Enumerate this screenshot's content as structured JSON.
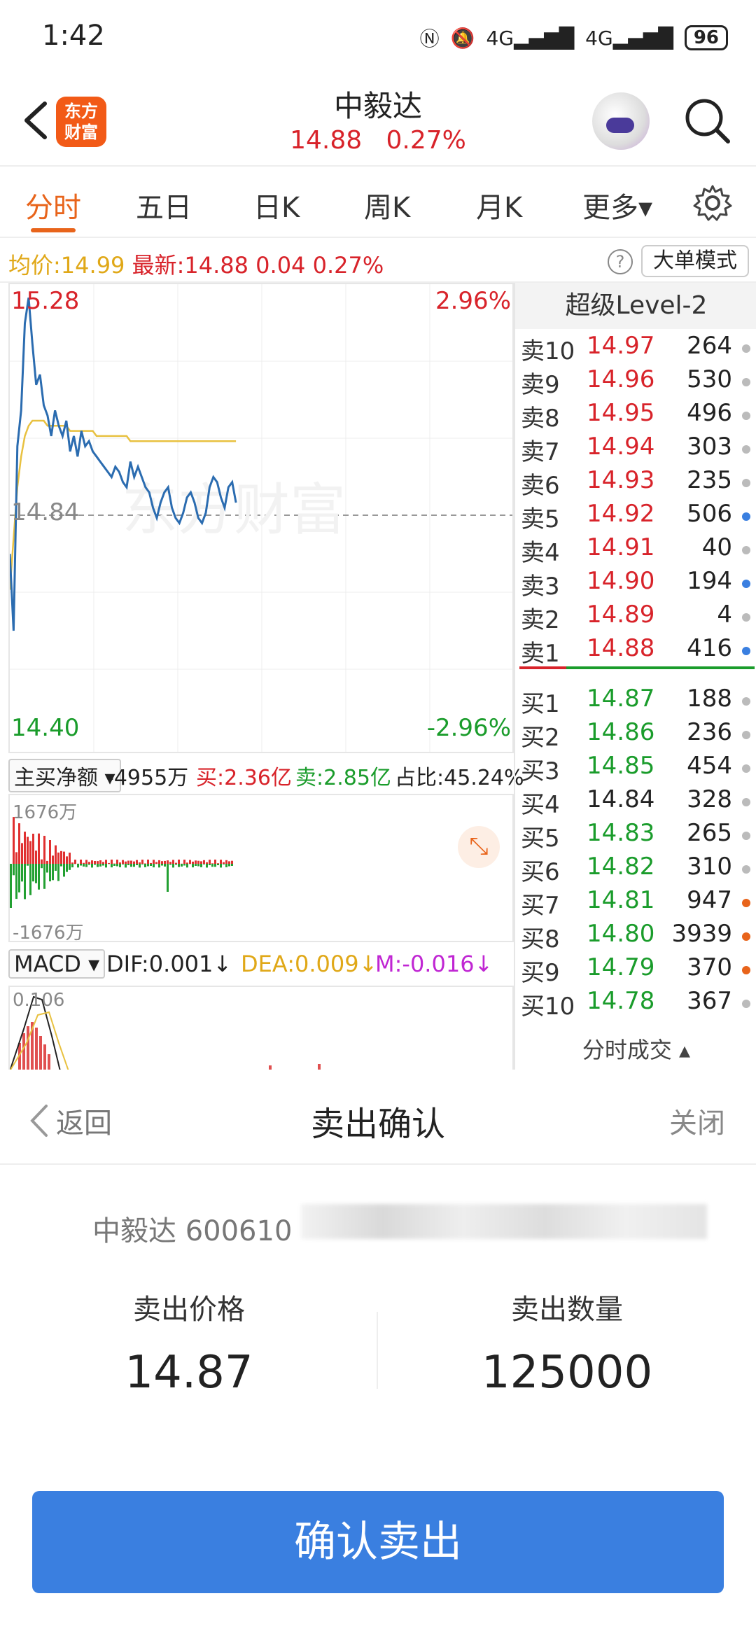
{
  "status": {
    "time": "1:42",
    "network1": "4G",
    "network2": "4G",
    "battery": "96"
  },
  "header": {
    "name": "中毅达",
    "price": "14.88",
    "change_pct": "0.27%",
    "logo_line1": "东方",
    "logo_line2": "财富"
  },
  "tabs": [
    "分时",
    "五日",
    "日K",
    "周K",
    "月K",
    "更多▾"
  ],
  "infobar": {
    "avg_label": "均价:",
    "avg": "14.99",
    "last_label": "最新:",
    "last": "14.88",
    "chg": "0.04",
    "pct": "0.27%",
    "help": "?",
    "mode": "大单模式"
  },
  "chart": {
    "top_price": "15.28",
    "top_pct": "2.96%",
    "base": "14.84",
    "bot_price": "14.40",
    "bot_pct": "-2.96%",
    "watermark": "东方财富"
  },
  "chart_data": {
    "type": "line",
    "ylim": [
      14.4,
      15.28
    ],
    "series": [
      {
        "name": "",
        "color": "#2b6cb0",
        "values": [
          14.77,
          14.62,
          14.98,
          15.05,
          15.22,
          15.27,
          15.18,
          15.1,
          15.12,
          15.06,
          15.04,
          15.0,
          15.05,
          15.02,
          15.0,
          15.03,
          14.97,
          15.0,
          14.96,
          15.01,
          14.98,
          14.99,
          14.97,
          14.96,
          14.95,
          14.94,
          14.93,
          14.92,
          14.94,
          14.93,
          14.91,
          14.9,
          14.95,
          14.92,
          14.94,
          14.92,
          14.9,
          14.89,
          14.86,
          14.84,
          14.87,
          14.89,
          14.9,
          14.86,
          14.84,
          14.83,
          14.85,
          14.88,
          14.89,
          14.87,
          14.84,
          14.83,
          14.85,
          14.9,
          14.92,
          14.91,
          14.88,
          14.86,
          14.9,
          14.91,
          14.87
        ]
      },
      {
        "name": "",
        "color": "#e8c140",
        "values": [
          14.7,
          14.8,
          14.9,
          14.96,
          15.0,
          15.02,
          15.03,
          15.03,
          15.03,
          15.03,
          15.02,
          15.02,
          15.02,
          15.02,
          15.02,
          15.02,
          15.01,
          15.01,
          15.01,
          15.01,
          15.01,
          15.01,
          15.01,
          15.0,
          15.0,
          15.0,
          15.0,
          15.0,
          15.0,
          15.0,
          15.0,
          15.0,
          14.99,
          14.99,
          14.99,
          14.99,
          14.99,
          14.99,
          14.99,
          14.99,
          14.99,
          14.99,
          14.99,
          14.99,
          14.99,
          14.99,
          14.99,
          14.99,
          14.99,
          14.99,
          14.99,
          14.99,
          14.99,
          14.99,
          14.99,
          14.99,
          14.99,
          14.99,
          14.99,
          14.99,
          14.99
        ]
      }
    ]
  },
  "flow": {
    "dropdown": "主买净额 ▾",
    "net": "-4955万",
    "buy": "买:2.36亿",
    "sell": "卖:2.85亿",
    "ratio": "占比:45.24%"
  },
  "vol": {
    "top": "1676万",
    "bot": "-1676万"
  },
  "macd": {
    "dropdown": "MACD ▾",
    "dif": "DIF:0.001↓",
    "dea": "DEA:0.009↓",
    "m": "M:-0.016↓",
    "top": "0.106"
  },
  "orderbook": {
    "title": "超级Level-2",
    "asks": [
      {
        "label": "卖10",
        "price": "14.97",
        "vol": "264",
        "dot": "#bbbbbb"
      },
      {
        "label": "卖9",
        "price": "14.96",
        "vol": "530",
        "dot": "#bbbbbb"
      },
      {
        "label": "卖8",
        "price": "14.95",
        "vol": "496",
        "dot": "#bbbbbb"
      },
      {
        "label": "卖7",
        "price": "14.94",
        "vol": "303",
        "dot": "#bbbbbb"
      },
      {
        "label": "卖6",
        "price": "14.93",
        "vol": "235",
        "dot": "#bbbbbb"
      },
      {
        "label": "卖5",
        "price": "14.92",
        "vol": "506",
        "dot": "#3a7fe0"
      },
      {
        "label": "卖4",
        "price": "14.91",
        "vol": "40",
        "dot": "#bbbbbb"
      },
      {
        "label": "卖3",
        "price": "14.90",
        "vol": "194",
        "dot": "#3a7fe0"
      },
      {
        "label": "卖2",
        "price": "14.89",
        "vol": "4",
        "dot": "#bbbbbb"
      },
      {
        "label": "卖1",
        "price": "14.88",
        "vol": "416",
        "dot": "#3a7fe0"
      }
    ],
    "bids": [
      {
        "label": "买1",
        "price": "14.87",
        "vol": "188",
        "dot": "#bbbbbb",
        "color": "#1a9c2b"
      },
      {
        "label": "买2",
        "price": "14.86",
        "vol": "236",
        "dot": "#bbbbbb",
        "color": "#1a9c2b"
      },
      {
        "label": "买3",
        "price": "14.85",
        "vol": "454",
        "dot": "#bbbbbb",
        "color": "#1a9c2b"
      },
      {
        "label": "买4",
        "price": "14.84",
        "vol": "328",
        "dot": "#bbbbbb",
        "color": "#222222"
      },
      {
        "label": "买5",
        "price": "14.83",
        "vol": "265",
        "dot": "#bbbbbb",
        "color": "#1a9c2b"
      },
      {
        "label": "买6",
        "price": "14.82",
        "vol": "310",
        "dot": "#bbbbbb",
        "color": "#1a9c2b"
      },
      {
        "label": "买7",
        "price": "14.81",
        "vol": "947",
        "dot": "#e8641b",
        "color": "#1a9c2b"
      },
      {
        "label": "买8",
        "price": "14.80",
        "vol": "3939",
        "dot": "#e8641b",
        "color": "#1a9c2b"
      },
      {
        "label": "买9",
        "price": "14.79",
        "vol": "370",
        "dot": "#e8641b",
        "color": "#1a9c2b"
      },
      {
        "label": "买10",
        "price": "14.78",
        "vol": "367",
        "dot": "#bbbbbb",
        "color": "#1a9c2b"
      }
    ],
    "footer": "分时成交 ▴"
  },
  "sheet": {
    "back": "返回",
    "title": "卖出确认",
    "close": "关闭",
    "stock": "中毅达 600610",
    "price_label": "卖出价格",
    "price": "14.87",
    "qty_label": "卖出数量",
    "qty": "125000",
    "confirm": "确认卖出"
  }
}
